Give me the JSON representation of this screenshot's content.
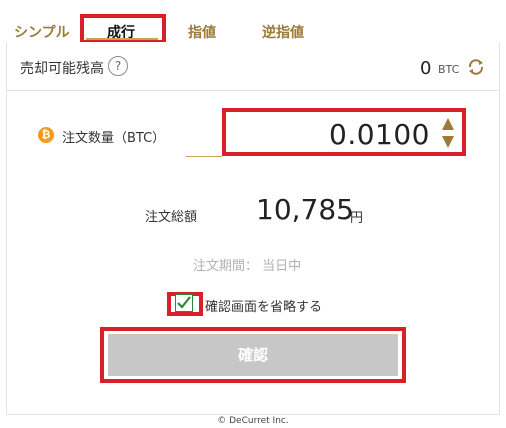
{
  "tabs": [
    {
      "label": "シンプル"
    },
    {
      "label": "成行"
    },
    {
      "label": "指値"
    },
    {
      "label": "逆指値"
    }
  ],
  "sellable": {
    "label": "売却可能残高",
    "help": "?",
    "value": "0",
    "unit": "BTC"
  },
  "quantity": {
    "label": "注文数量（BTC）",
    "value": "0.0100",
    "currency_icon": "bitcoin-icon"
  },
  "total": {
    "label": "注文総額",
    "value": "10,785",
    "unit": "円"
  },
  "period": {
    "label": "注文期間： 当日中"
  },
  "skip_confirm": {
    "label": "確認画面を省略する",
    "checked": true
  },
  "confirm_button": {
    "label": "確認"
  },
  "footer": {
    "text": "© DeCurret Inc."
  },
  "colors": {
    "accent": "#9b7b37",
    "highlight": "#d8202a",
    "button_disabled": "#c7c7c7",
    "bitcoin": "#f29a1c"
  }
}
